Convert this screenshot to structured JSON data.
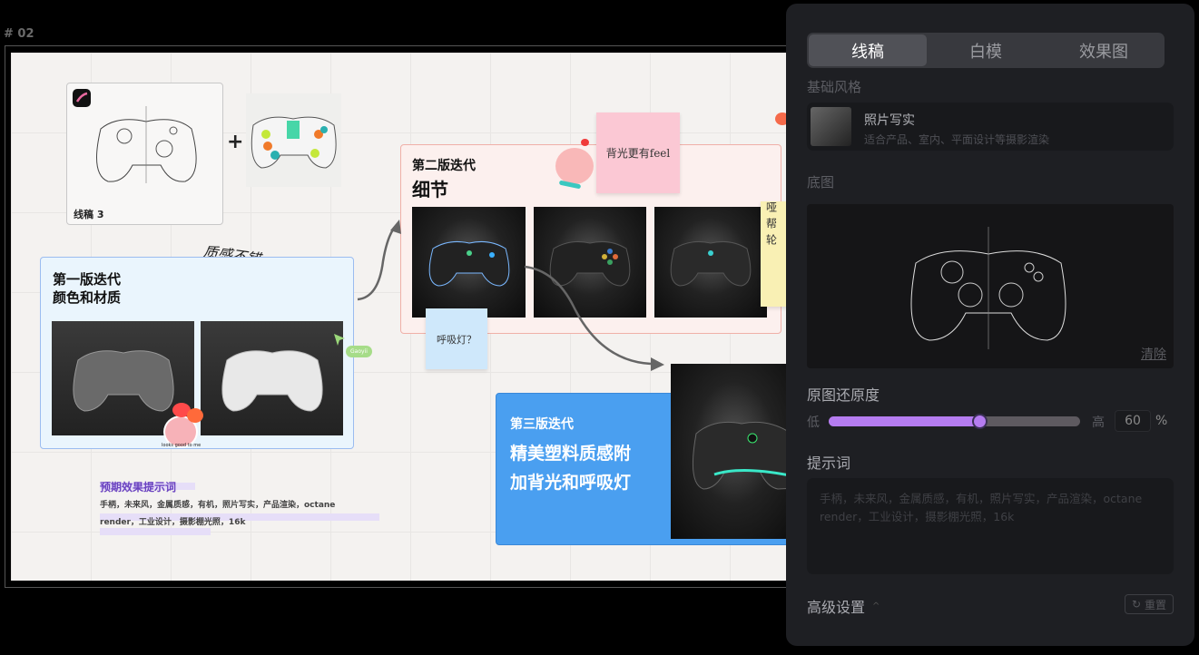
{
  "frame": {
    "label": "# 02"
  },
  "canvas": {
    "sketch_card": {
      "label": "线稿 3",
      "app_icon": "procreate-icon"
    },
    "plus": "+",
    "iteration1": {
      "title_line1": "第一版迭代",
      "title_line2": "颜色和材质"
    },
    "handwriting_note": "质感不错",
    "user_tag": "Gaoyii",
    "sticker_text": "looks good to me",
    "prompt_block": {
      "title": "预期效果提示词",
      "line1": "手柄，未来风，金属质感，有机，照片写实，产品渲染，octane",
      "line2": "render，工业设计，摄影棚光照，16k"
    },
    "iteration2": {
      "title_line1": "第二版迭代",
      "title_line2": "细节"
    },
    "sticky_pink": "背光更有feel",
    "sticky_blue": "呼吸灯？",
    "sticky_yellow": "哑帮轮",
    "iteration3": {
      "title_line1": "第三版迭代",
      "title_line2": "精美塑料质感附",
      "title_line3": "加背光和呼吸灯"
    }
  },
  "panel": {
    "tabs": [
      {
        "label": "线稿",
        "active": true
      },
      {
        "label": "白模",
        "active": false
      },
      {
        "label": "效果图",
        "active": false
      }
    ],
    "base_style_label": "基础风格",
    "style": {
      "name": "照片写实",
      "description": "适合产品、室内、平面设计等摄影渲染"
    },
    "base_image_label": "底图",
    "clear_label": "清除",
    "fidelity": {
      "label": "原图还原度",
      "low": "低",
      "high": "高",
      "value": "60",
      "unit": "%",
      "accent": "#b57cf0"
    },
    "prompt": {
      "label": "提示词",
      "placeholder": "手柄，未来风，金属质感，有机，照片写实，产品渲染，octane render，工业设计，摄影棚光照，16k"
    },
    "advanced": {
      "label": "高级设置",
      "reset_label": "重置"
    }
  }
}
